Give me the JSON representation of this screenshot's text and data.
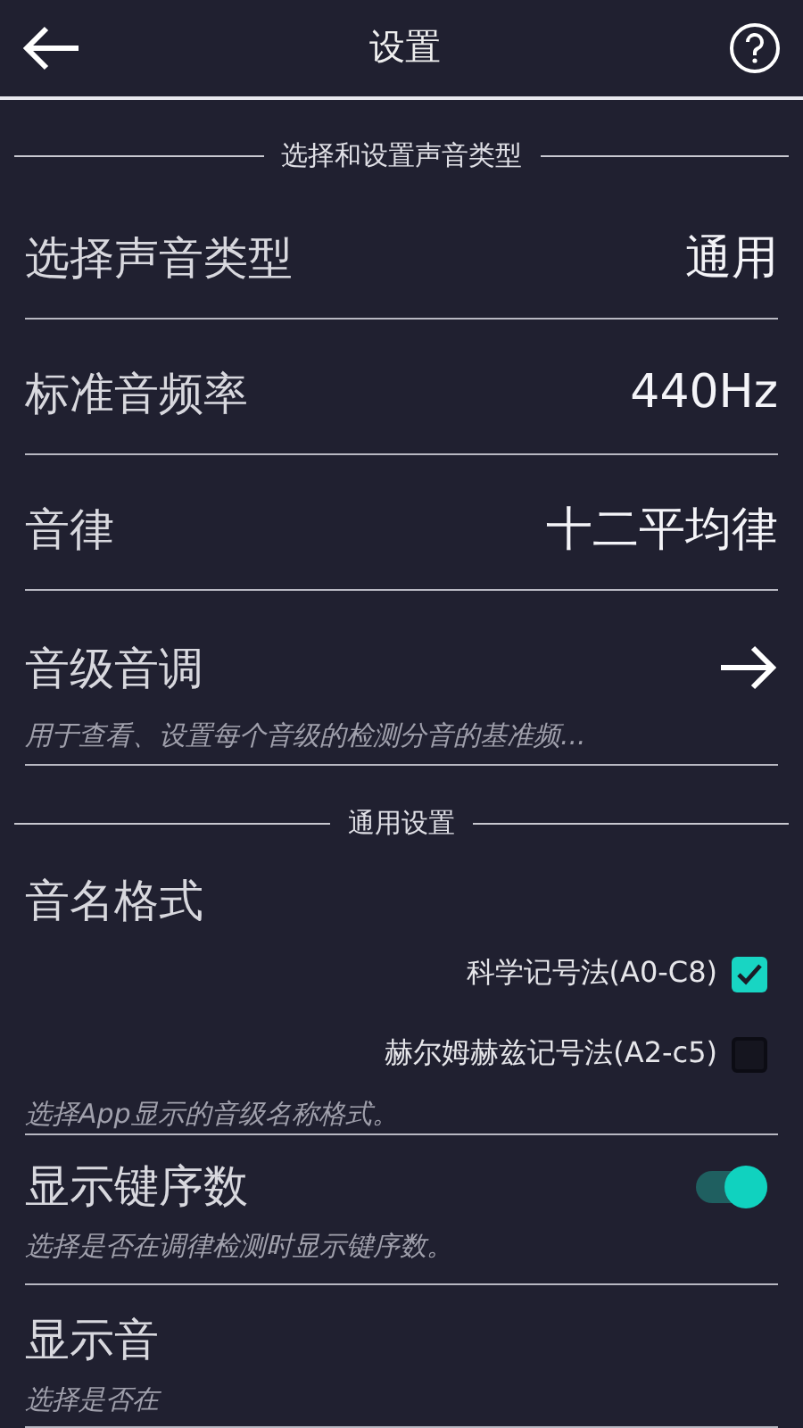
{
  "header": {
    "title": "设置"
  },
  "sections": [
    {
      "title": "选择和设置声音类型",
      "items": [
        {
          "kind": "value",
          "label": "选择声音类型",
          "value": "通用"
        },
        {
          "kind": "value",
          "label": "标准音频率",
          "value": "440Hz"
        },
        {
          "kind": "value",
          "label": "音律",
          "value": "十二平均律"
        },
        {
          "kind": "link",
          "label": "音级音调",
          "description": "用于查看、设置每个音级的检测分音的基准频..."
        }
      ]
    },
    {
      "title": "通用设置",
      "items": [
        {
          "kind": "options",
          "label": "音名格式",
          "options": [
            {
              "label": "科学记号法(A0-C8)",
              "checked": true
            },
            {
              "label": "赫尔姆赫兹记号法(A2-c5)",
              "checked": false
            }
          ],
          "description": "选择App显示的音级名称格式。"
        },
        {
          "kind": "switch",
          "label": "显示键序数",
          "on": true,
          "description": "选择是否在调律检测时显示键序数。"
        },
        {
          "kind": "plain",
          "label": "显示音",
          "description": "选择是否在"
        }
      ]
    }
  ]
}
